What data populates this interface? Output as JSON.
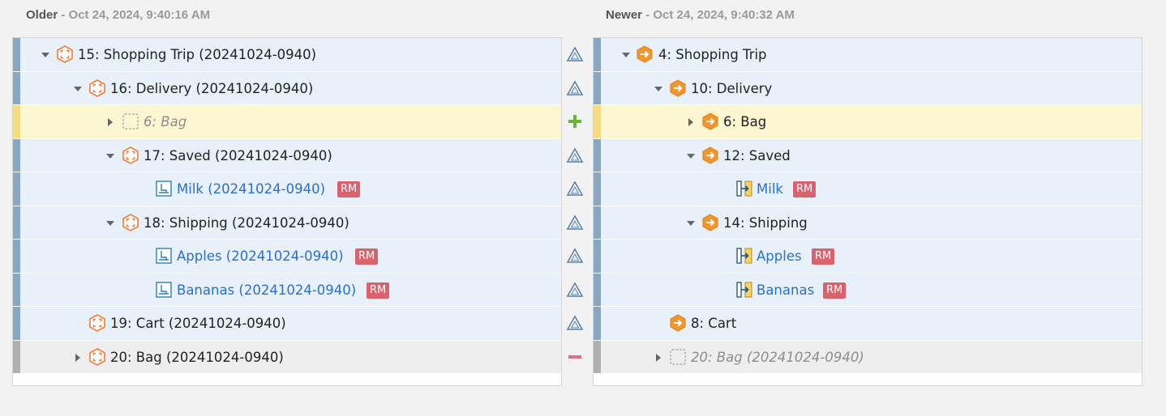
{
  "older": {
    "label": "Older",
    "sep": " - ",
    "timestamp": "Oct 24, 2024, 9:40:16 AM"
  },
  "newer": {
    "label": "Newer",
    "sep": " - ",
    "timestamp": "Oct 24, 2024, 9:40:32 AM"
  },
  "rows": [
    {
      "status": "modified",
      "left": {
        "label": "15: Shopping Trip (20241024-0940)",
        "icon": "hex-frame-icon"
      },
      "right": {
        "label": "4: Shopping Trip",
        "icon": "hex-arrow-icon"
      },
      "gutter": "triangle-change-icon"
    },
    {
      "status": "modified",
      "left": {
        "label": "16: Delivery (20241024-0940)",
        "icon": "hex-frame-icon"
      },
      "right": {
        "label": "10: Delivery",
        "icon": "hex-arrow-icon"
      },
      "gutter": "triangle-change-icon"
    },
    {
      "status": "added",
      "left": {
        "label": "6: Bag",
        "icon": "placeholder-icon"
      },
      "right": {
        "label": "6: Bag",
        "icon": "hex-arrow-icon"
      },
      "gutter": "plus-add-icon"
    },
    {
      "status": "modified",
      "left": {
        "label": "17: Saved (20241024-0940)",
        "icon": "hex-frame-icon"
      },
      "right": {
        "label": "12: Saved",
        "icon": "hex-arrow-icon"
      },
      "gutter": "triangle-change-icon"
    },
    {
      "status": "modified",
      "left": {
        "label": "Milk (20241024-0940)",
        "icon": "item-icon",
        "badge": "RM"
      },
      "right": {
        "label": "Milk",
        "icon": "link-item-icon",
        "badge": "RM"
      },
      "gutter": "triangle-change-icon"
    },
    {
      "status": "modified",
      "left": {
        "label": "18: Shipping (20241024-0940)",
        "icon": "hex-frame-icon"
      },
      "right": {
        "label": "14: Shipping",
        "icon": "hex-arrow-icon"
      },
      "gutter": "triangle-change-icon"
    },
    {
      "status": "modified",
      "left": {
        "label": "Apples (20241024-0940)",
        "icon": "item-icon",
        "badge": "RM"
      },
      "right": {
        "label": "Apples",
        "icon": "link-item-icon",
        "badge": "RM"
      },
      "gutter": "triangle-change-icon"
    },
    {
      "status": "modified",
      "left": {
        "label": "Bananas (20241024-0940)",
        "icon": "item-icon",
        "badge": "RM"
      },
      "right": {
        "label": "Bananas",
        "icon": "link-item-icon",
        "badge": "RM"
      },
      "gutter": "triangle-change-icon"
    },
    {
      "status": "modified",
      "left": {
        "label": "19: Cart (20241024-0940)",
        "icon": "hex-frame-icon"
      },
      "right": {
        "label": "8: Cart",
        "icon": "hex-arrow-icon"
      },
      "gutter": "triangle-change-icon"
    },
    {
      "status": "deleted",
      "left": {
        "label": "20: Bag (20241024-0940)",
        "icon": "hex-frame-icon"
      },
      "right": {
        "label": "20: Bag (20241024-0940)",
        "icon": "placeholder-icon"
      },
      "gutter": "minus-remove-icon"
    }
  ]
}
